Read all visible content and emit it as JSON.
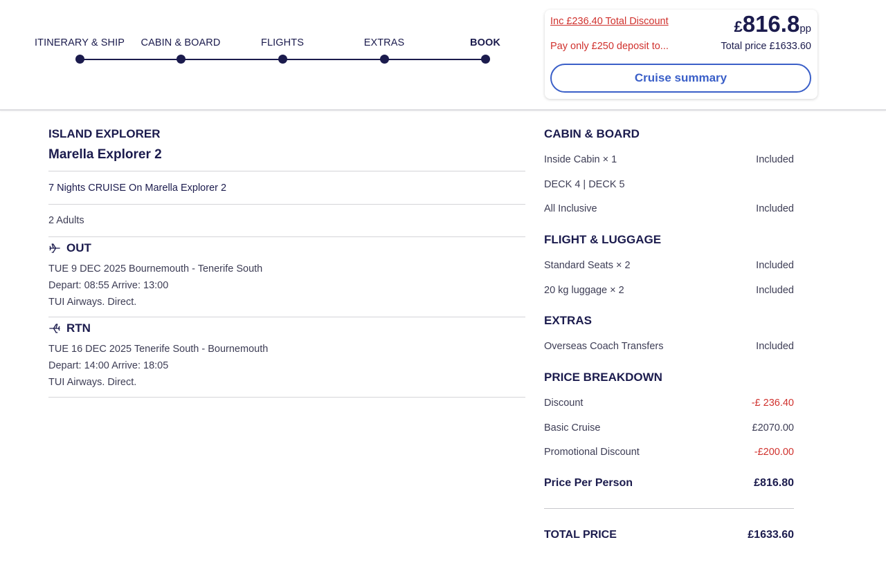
{
  "steps": [
    {
      "label": "ITINERARY & SHIP",
      "active": false
    },
    {
      "label": "CABIN & BOARD",
      "active": false
    },
    {
      "label": "FLIGHTS",
      "active": false
    },
    {
      "label": "EXTRAS",
      "active": false
    },
    {
      "label": "BOOK",
      "active": true
    }
  ],
  "price_card": {
    "discount_text": "Inc £236.40 Total Discount",
    "deposit_text": "Pay only £250 deposit to...",
    "currency": "£",
    "pp_amount": "816.8",
    "pp_suffix": "pp",
    "total_text": "Total price £1633.60",
    "summary_button": "Cruise summary"
  },
  "trip": {
    "title": "ISLAND EXPLORER",
    "ship": "Marella Explorer 2",
    "nights": "7 Nights CRUISE On Marella Explorer 2",
    "pax": "2  Adults"
  },
  "flights": {
    "out": {
      "label": "OUT",
      "route": "TUE 9 DEC 2025 Bournemouth  - Tenerife South",
      "times": "Depart: 08:55 Arrive: 13:00",
      "carrier": "TUI Airways. Direct."
    },
    "rtn": {
      "label": "RTN",
      "route": "TUE 16 DEC 2025 Tenerife South - Bournemouth",
      "times": "Depart: 14:00 Arrive: 18:05",
      "carrier": "TUI Airways. Direct."
    }
  },
  "cabin": {
    "heading": "CABIN & BOARD",
    "rows": [
      {
        "label": "Inside Cabin × 1",
        "value": "Included"
      },
      {
        "label": "DECK 4 | DECK 5",
        "value": ""
      },
      {
        "label": "All Inclusive",
        "value": "Included"
      }
    ]
  },
  "flight_luggage": {
    "heading": "FLIGHT & LUGGAGE",
    "rows": [
      {
        "label": "Standard Seats × 2",
        "value": "Included"
      },
      {
        "label": "20 kg luggage × 2",
        "value": "Included"
      }
    ]
  },
  "extras": {
    "heading": "EXTRAS",
    "rows": [
      {
        "label": "Overseas Coach Transfers",
        "value": "Included"
      }
    ]
  },
  "breakdown": {
    "heading": "PRICE BREAKDOWN",
    "rows": [
      {
        "label": "Discount",
        "value": "-£ 236.40"
      },
      {
        "label": "Basic Cruise",
        "value": "£2070.00"
      },
      {
        "label": "Promotional Discount",
        "value": "-£200.00"
      }
    ],
    "ppp_label": "Price Per Person",
    "ppp_value": "£816.80",
    "total_label": "TOTAL PRICE",
    "total_value": "£1633.60"
  },
  "colors": {
    "navy": "#1b1b4d",
    "discount_red": "#d0312d",
    "button_blue": "#3a5fc8"
  }
}
